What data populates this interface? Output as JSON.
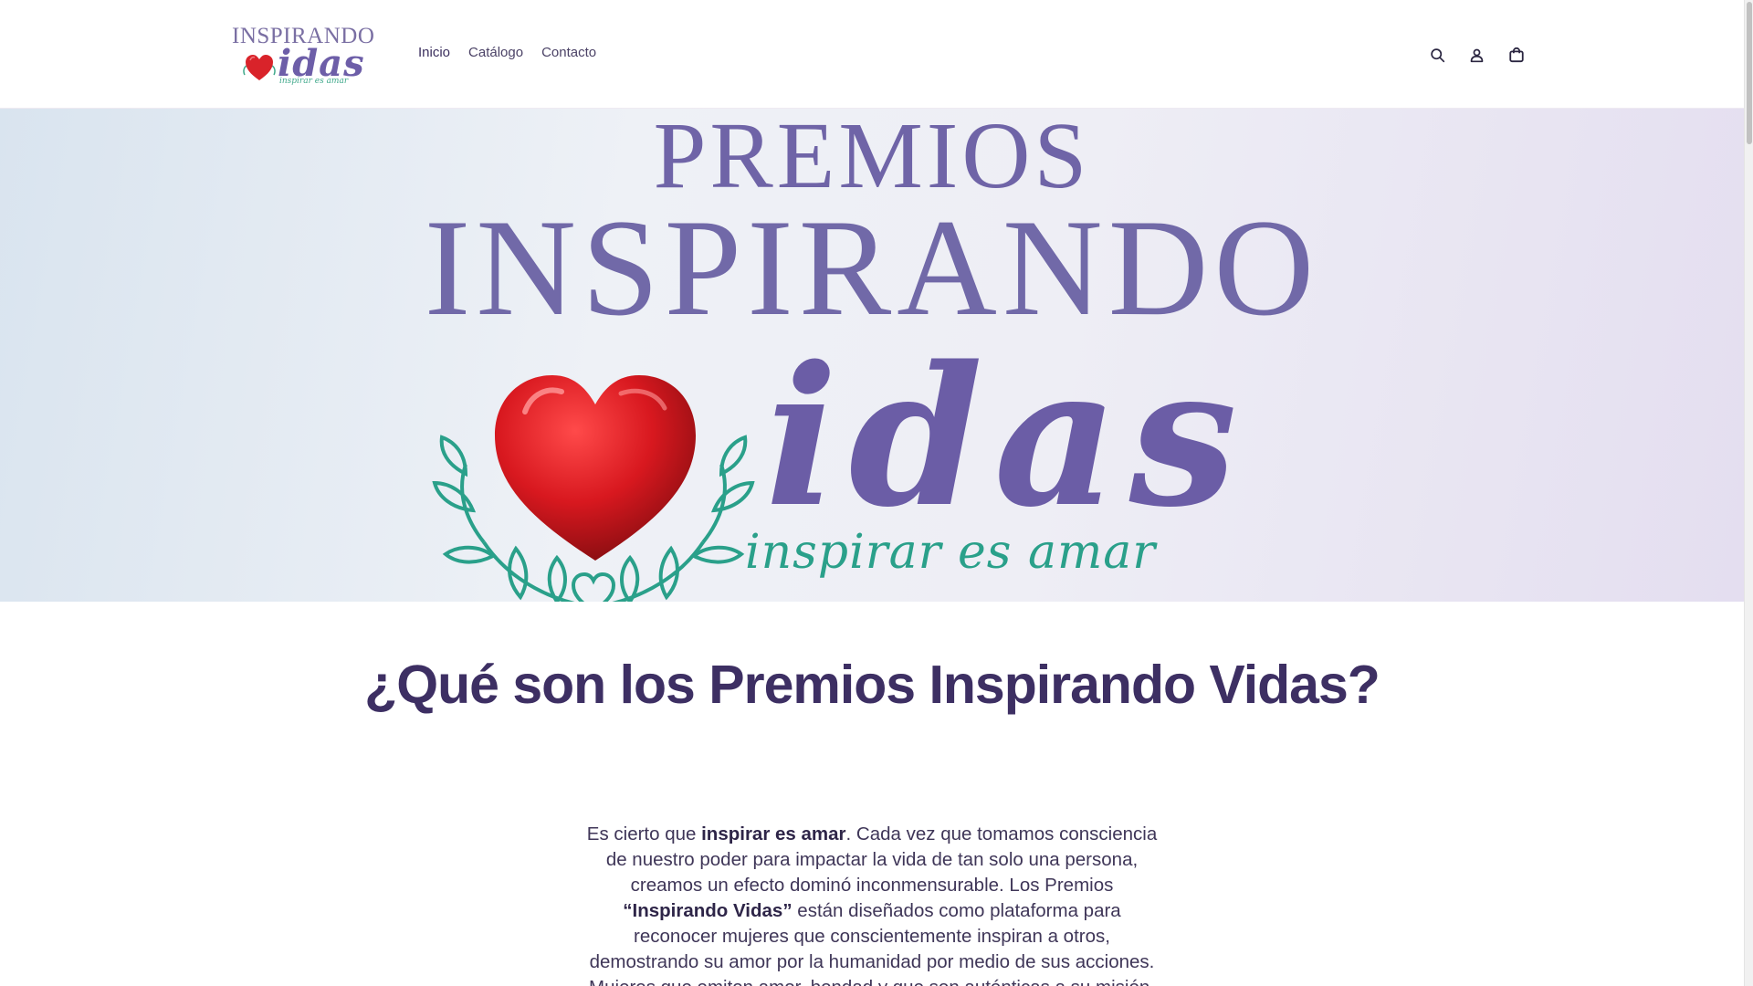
{
  "logo": {
    "top_text": "INSPIRANDO",
    "word": "idas",
    "tagline": "inspirar es amar"
  },
  "nav": {
    "items": [
      "Inicio",
      "Catálogo",
      "Contacto"
    ]
  },
  "header_icons": [
    "search-icon",
    "account-icon",
    "cart-icon"
  ],
  "hero": {
    "line1": "PREMIOS",
    "line2": "INSPIRANDO",
    "word": "idas",
    "tagline": "inspirar es amar"
  },
  "section": {
    "title": "¿Qué son los Premios Inspirando Vidas?",
    "p1_a": "Es cierto que ",
    "p1_b": "inspirar es amar",
    "p1_c": ". Cada vez que tomamos consciencia de nuestro poder para impactar la vida de tan solo una persona, creamos un efecto dominó inconmensurable. Los Premios ",
    "p1_d": "“Inspirando Vidas”",
    "p1_e": " están diseñados como plataforma para reconocer mujeres que conscientemente inspiran a otros, demostrando su amor por la humanidad por medio de sus acciones. Mujeres que emiten amor, bondad y que son auténticas a su misión."
  },
  "colors": {
    "brand_purple": "#6f64a7",
    "title_purple": "#3d2f63",
    "heart_red": "#d9232a",
    "leaf_green": "#2aa08a"
  }
}
